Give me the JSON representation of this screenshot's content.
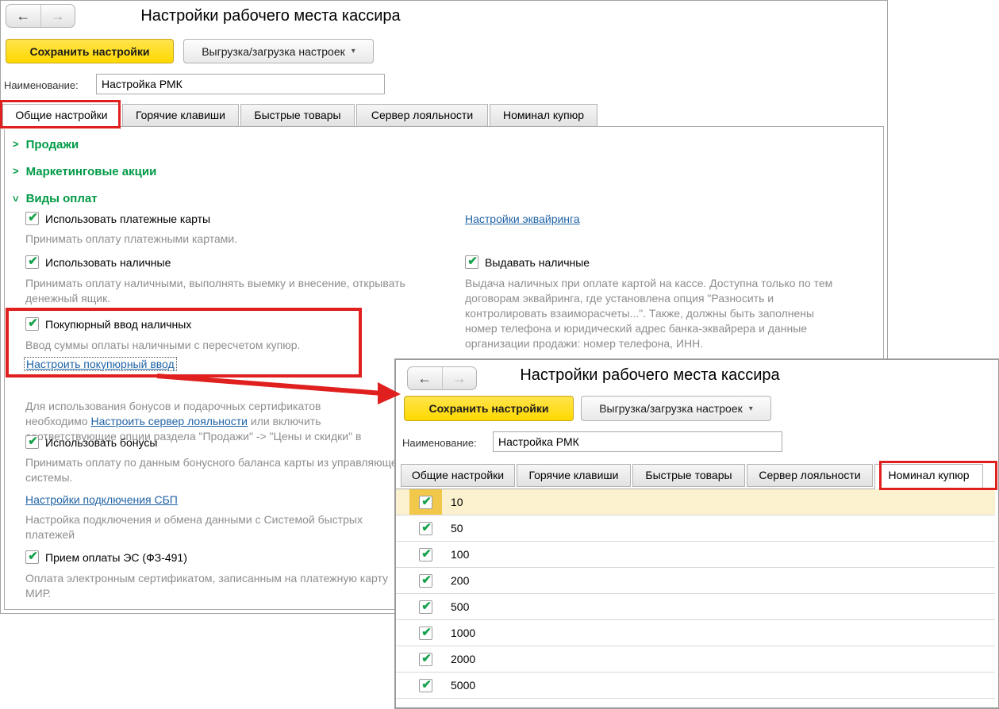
{
  "glyphs": {
    "back": "←",
    "forward": "→",
    "caret": "▾",
    "check": "✔",
    "chevron": ">"
  },
  "win1": {
    "title": "Настройки рабочего места кассира",
    "save_button": "Сохранить настройки",
    "export_button": "Выгрузка/загрузка настроек",
    "name_label": "Наименование:",
    "name_value": "Настройка РМК",
    "tabs": [
      {
        "label": "Общие настройки",
        "active": true
      },
      {
        "label": "Горячие клавиши",
        "active": false
      },
      {
        "label": "Быстрые товары",
        "active": false
      },
      {
        "label": "Сервер лояльности",
        "active": false
      },
      {
        "label": "Номинал купюр",
        "active": false
      }
    ],
    "sections": [
      {
        "label": "Продажи",
        "state": "collapsed"
      },
      {
        "label": "Маркетинговые акции",
        "state": "collapsed"
      },
      {
        "label": "Виды оплат",
        "state": "expanded"
      }
    ],
    "left": {
      "cb_cards_label": "Использовать платежные карты",
      "cb_cards_desc": "Принимать оплату платежными картами.",
      "cb_cash_label": "Использовать наличные",
      "cb_cash_desc": "Принимать оплату наличными, выполнять выемку и внесение, открывать\nденежный ящик.",
      "cb_bills_label": "Покупюрный ввод наличных",
      "cb_bills_desc": "Ввод суммы оплаты наличными с пересчетом купюр.",
      "bills_link": "Настроить покупюрный ввод",
      "bonus_info_part1": "Для использования бонусов и подарочных сертификатов\nнеобходимо  ",
      "bonus_info_link": "Настроить сервер лояльности",
      "bonus_info_part2": " или включить\nсоответствующие опции раздела \"Продажи\" -> \"Цены и скидки\" в",
      "cb_bonus_label": "Использовать бонусы",
      "cb_bonus_desc": "Принимать оплату по данным бонусного баланса карты из управляющей\nсистемы.",
      "sbp_link": "Настройки подключения СБП",
      "sbp_desc": "Настройка подключения и обмена данными с Системой быстрых\nплатежей",
      "cb_es_label": "Прием оплаты ЭС (ФЗ-491)",
      "cb_es_desc": "Оплата электронным сертификатом, записанным на платежную карту\nМИР."
    },
    "right": {
      "acquiring_link": "Настройки эквайринга",
      "cb_giveout_label": "Выдавать наличные",
      "cb_giveout_desc": "Выдача наличных при оплате картой на кассе. Доступна только по тем\nдоговорам эквайринга, где установлена опция \"Разносить и\nконтролировать взаиморасчеты...\". Также, должны быть заполнены\nномер телефона и юридический адрес банка-эквайрера и данные\nорганизации продажи: номер телефона, ИНН."
    }
  },
  "win2": {
    "title": "Настройки рабочего места кассира",
    "save_button": "Сохранить настройки",
    "export_button": "Выгрузка/загрузка настроек",
    "name_label": "Наименование:",
    "name_value": "Настройка РМК",
    "tabs": [
      {
        "label": "Общие настройки",
        "active": false
      },
      {
        "label": "Горячие клавиши",
        "active": false
      },
      {
        "label": "Быстрые товары",
        "active": false
      },
      {
        "label": "Сервер лояльности",
        "active": false
      },
      {
        "label": "Номинал купюр",
        "active": true
      }
    ],
    "denominations": [
      "10",
      "50",
      "100",
      "200",
      "500",
      "1000",
      "2000",
      "5000"
    ]
  },
  "annotation_color": "#e01f1f"
}
